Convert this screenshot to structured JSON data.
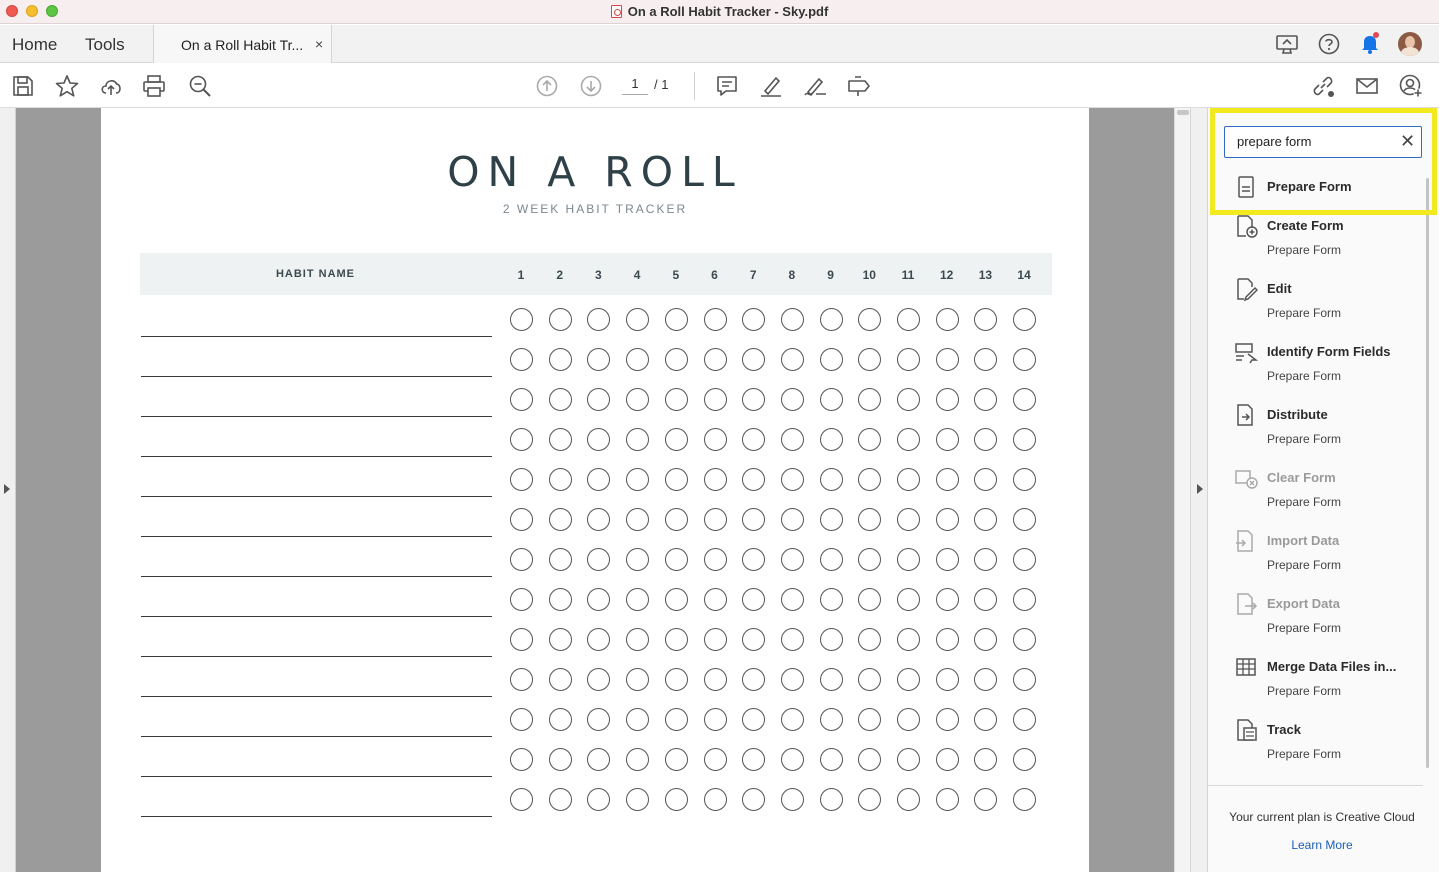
{
  "window": {
    "title": "On a Roll Habit Tracker - Sky.pdf"
  },
  "tabbar": {
    "home": "Home",
    "tools": "Tools",
    "doc_tab": "On a Roll Habit Tr...",
    "close": "×"
  },
  "toolbar": {
    "page_current": "1",
    "page_total": "/ 1"
  },
  "document": {
    "title": "ON A ROLL",
    "subtitle": "2 WEEK HABIT TRACKER",
    "habit_header": "HABIT NAME",
    "days": [
      "1",
      "2",
      "3",
      "4",
      "5",
      "6",
      "7",
      "8",
      "9",
      "10",
      "11",
      "12",
      "13",
      "14"
    ]
  },
  "panel": {
    "search_value": "prepare form",
    "clear": "✕",
    "results": [
      {
        "title": "Prepare Form",
        "sub": "",
        "icon": "prepare-form-icon"
      },
      {
        "title": "Create Form",
        "sub": "Prepare Form",
        "icon": "create-form-icon"
      },
      {
        "title": "Edit",
        "sub": "Prepare Form",
        "icon": "edit-form-icon"
      },
      {
        "title": "Identify Form Fields",
        "sub": "Prepare Form",
        "icon": "identify-fields-icon"
      },
      {
        "title": "Distribute",
        "sub": "Prepare Form",
        "icon": "distribute-icon"
      },
      {
        "title": "Clear Form",
        "sub": "Prepare Form",
        "icon": "clear-form-icon",
        "disabled": true
      },
      {
        "title": "Import Data",
        "sub": "Prepare Form",
        "icon": "import-data-icon",
        "disabled": true
      },
      {
        "title": "Export Data",
        "sub": "Prepare Form",
        "icon": "export-data-icon",
        "disabled": true
      },
      {
        "title": "Merge Data Files in...",
        "sub": "Prepare Form",
        "icon": "merge-data-icon"
      },
      {
        "title": "Track",
        "sub": "Prepare Form",
        "icon": "track-icon"
      }
    ],
    "plan": "Your current plan is Creative Cloud",
    "learn_more": "Learn More"
  },
  "colors": {
    "highlight": "#f2ea1f",
    "accent": "#1a5fb4",
    "notification": "#1473e6"
  }
}
